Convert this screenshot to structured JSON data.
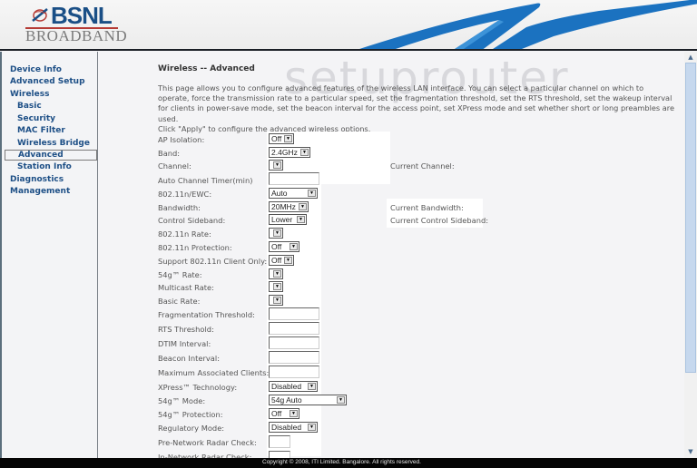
{
  "header": {
    "logo_brand": "BSNL",
    "logo_sub": "BROADBAND"
  },
  "sidebar": {
    "items": [
      {
        "label": "Device Info",
        "level": "top"
      },
      {
        "label": "Advanced Setup",
        "level": "top"
      },
      {
        "label": "Wireless",
        "level": "top"
      },
      {
        "label": "Basic",
        "level": "sub"
      },
      {
        "label": "Security",
        "level": "sub"
      },
      {
        "label": "MAC Filter",
        "level": "sub"
      },
      {
        "label": "Wireless Bridge",
        "level": "sub"
      },
      {
        "label": "Advanced",
        "level": "sub",
        "active": true
      },
      {
        "label": "Station Info",
        "level": "sub"
      },
      {
        "label": "Diagnostics",
        "level": "top"
      },
      {
        "label": "Management",
        "level": "top"
      }
    ]
  },
  "main": {
    "watermark": "setuprouter",
    "title": "Wireless -- Advanced",
    "description": "This page allows you to configure advanced features of the wireless LAN interface. You can select a particular channel on which to operate, force the transmission rate to a particular speed, set the fragmentation threshold, set the RTS threshold, set the wakeup interval for clients in power-save mode, set the beacon interval for the access point, set XPress mode and set whether short or long preambles are used.",
    "apply_hint": "Click \"Apply\" to configure the advanced wireless options.",
    "fields": {
      "ap_isolation": {
        "label": "AP Isolation:",
        "value": "Off"
      },
      "band": {
        "label": "Band:",
        "value": "2.4GHz"
      },
      "channel": {
        "label": "Channel:",
        "value": ""
      },
      "auto_channel_timer": {
        "label": "Auto Channel Timer(min)",
        "value": ""
      },
      "ewc": {
        "label": "802.11n/EWC:",
        "value": "Auto"
      },
      "bandwidth": {
        "label": "Bandwidth:",
        "value": "20MHz"
      },
      "control_sideband": {
        "label": "Control Sideband:",
        "value": "Lower"
      },
      "n_rate": {
        "label": "802.11n Rate:",
        "value": ""
      },
      "n_protection": {
        "label": "802.11n Protection:",
        "value": "Off"
      },
      "n_client_only": {
        "label": "Support 802.11n Client Only:",
        "value": "Off"
      },
      "g_rate": {
        "label": "54g™ Rate:",
        "value": ""
      },
      "multicast_rate": {
        "label": "Multicast Rate:",
        "value": ""
      },
      "basic_rate": {
        "label": "Basic Rate:",
        "value": ""
      },
      "frag_threshold": {
        "label": "Fragmentation Threshold:",
        "value": ""
      },
      "rts_threshold": {
        "label": "RTS Threshold:",
        "value": ""
      },
      "dtim_interval": {
        "label": "DTIM Interval:",
        "value": ""
      },
      "beacon_interval": {
        "label": "Beacon Interval:",
        "value": ""
      },
      "max_clients": {
        "label": "Maximum Associated Clients:",
        "value": ""
      },
      "xpress": {
        "label": "XPress™ Technology:",
        "value": "Disabled"
      },
      "g_mode": {
        "label": "54g™ Mode:",
        "value": "54g Auto"
      },
      "g_protection": {
        "label": "54g™ Protection:",
        "value": "Off"
      },
      "regulatory_mode": {
        "label": "Regulatory Mode:",
        "value": "Disabled"
      },
      "pre_network_radar": {
        "label": "Pre-Network Radar Check:",
        "value": ""
      },
      "in_network_radar": {
        "label": "In-Network Radar Check:",
        "value": ""
      }
    },
    "status": {
      "current_channel": "Current Channel:",
      "current_bandwidth": "Current Bandwidth:",
      "current_sideband": "Current Control Sideband:"
    }
  },
  "footer": {
    "copyright": "Copyright © 2008, ITI Limited. Bangalore. All rights reserved."
  },
  "colors": {
    "nav_text": "#1d4f86",
    "brand_blue": "#1a4f86",
    "swoosh_blue": "#1b72c0"
  }
}
